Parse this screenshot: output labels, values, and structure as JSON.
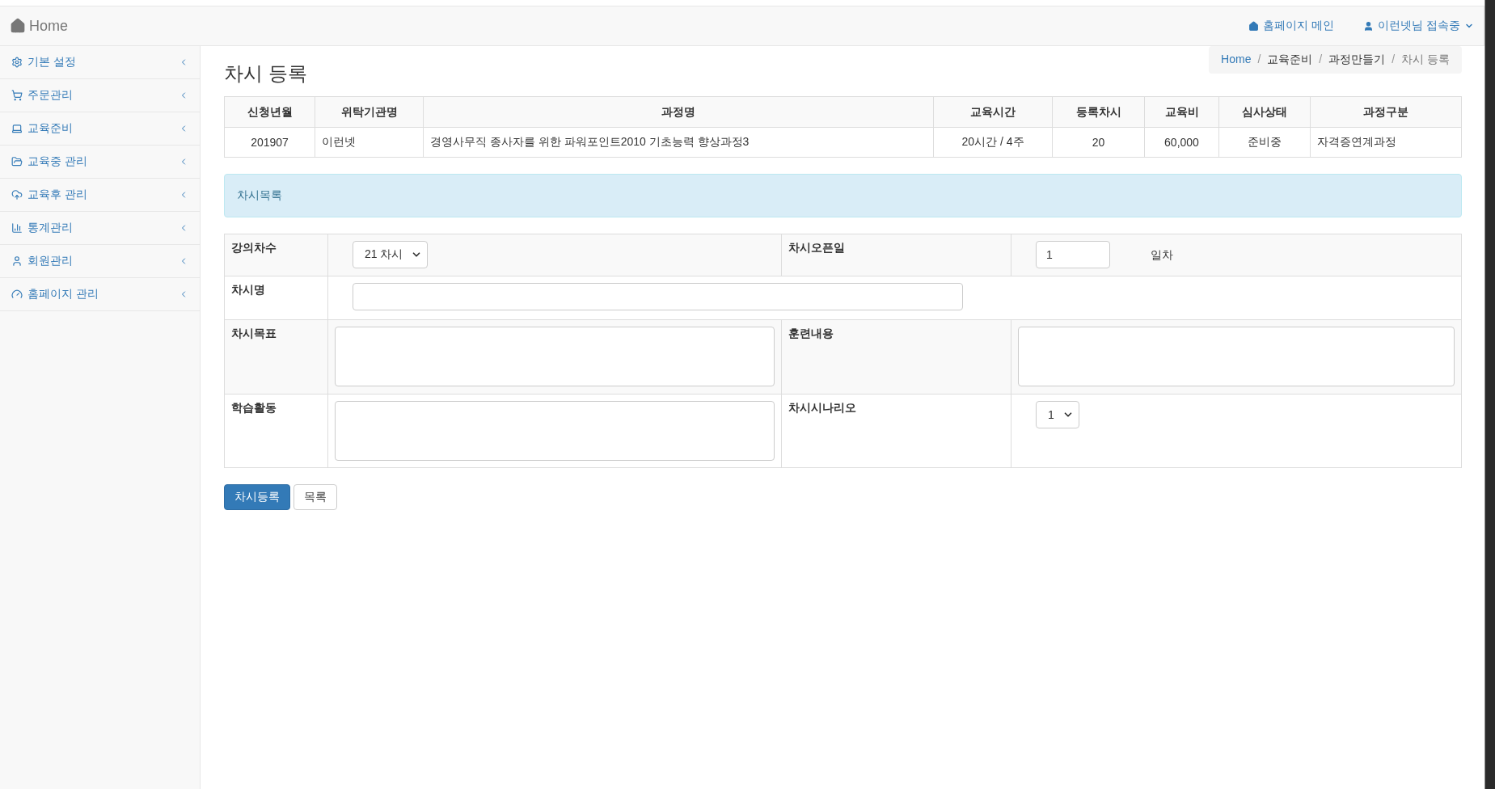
{
  "navbar": {
    "brand": "Home",
    "links": [
      {
        "label": "홈페이지 메인",
        "kind": "home"
      },
      {
        "label": "이런넷님 접속중",
        "kind": "user"
      }
    ]
  },
  "sidebar": {
    "items": [
      {
        "label": "기본 설정"
      },
      {
        "label": "주문관리"
      },
      {
        "label": "교육준비"
      },
      {
        "label": "교육중 관리"
      },
      {
        "label": "교육후 관리"
      },
      {
        "label": "통계관리"
      },
      {
        "label": "회원관리"
      },
      {
        "label": "홈페이지 관리"
      }
    ]
  },
  "page_title": "차시 등록",
  "breadcrumb": [
    {
      "label": "Home",
      "kind": "link"
    },
    {
      "label": "교육준비",
      "kind": "text",
      "separator": "/"
    },
    {
      "label": "과정만들기",
      "kind": "text",
      "separator": "/"
    },
    {
      "label": "차시 등록",
      "kind": "active",
      "separator": "/"
    }
  ],
  "course_table": {
    "columns": [
      "신청년월",
      "위탁기관명",
      "과정명",
      "교육시간",
      "등록차시",
      "교육비",
      "심사상태",
      "과정구분"
    ],
    "rows": [
      [
        "201907",
        "이런넷",
        "경영사무직 종사자를 위한 파워포인트2010 기초능력 향상과정3",
        "20시간 / 4주",
        "20",
        "60,000",
        "준비중",
        "자격증연계과정"
      ]
    ]
  },
  "panel": {
    "title": "차시목록"
  },
  "form": {
    "rows": [
      {
        "cells": [
          {
            "label": "강의차수",
            "control": {
              "kind": "select",
              "value": "21 차시"
            }
          },
          {
            "label": "차시오픈일",
            "control": {
              "kind": "input",
              "value": "1",
              "suffix": "일차"
            }
          }
        ]
      },
      {
        "cells": [
          {
            "label": "차시명",
            "control": {
              "kind": "input"
            }
          }
        ]
      },
      {
        "cells": [
          {
            "label": "차시목표",
            "control": {
              "kind": "textarea"
            }
          },
          {
            "label": "훈련내용",
            "control": {
              "kind": "textarea"
            }
          }
        ]
      },
      {
        "cells": [
          {
            "label": "학습활동",
            "control": {
              "kind": "textarea"
            }
          },
          {
            "label": "차시시나리오",
            "control": {
              "kind": "select",
              "value": "1"
            }
          }
        ]
      }
    ]
  },
  "buttons": [
    {
      "label": "차시등록",
      "kind": "primary"
    },
    {
      "label": "목록",
      "kind": "default"
    }
  ]
}
